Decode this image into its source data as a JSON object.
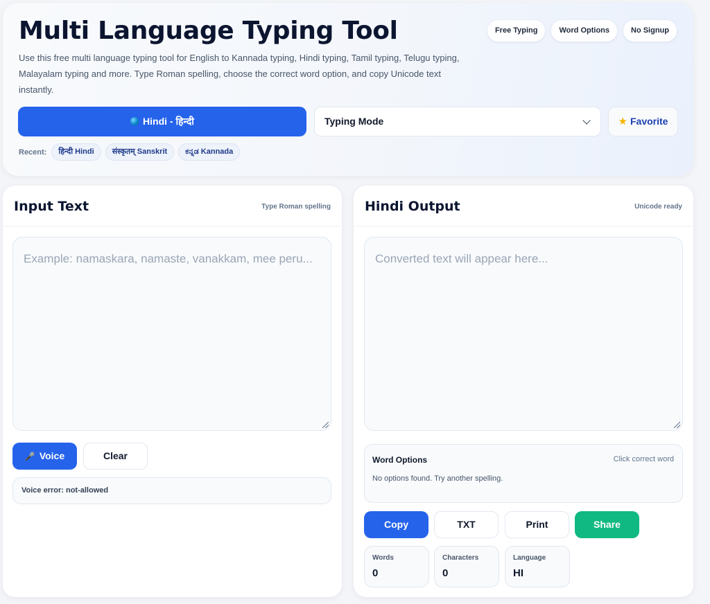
{
  "hero": {
    "title": "Multi Language Typing Tool",
    "description": "Use this free multi language typing tool for English to Kannada typing, Hindi typing, Tamil typing, Telugu typing, Malayalam typing and more. Type Roman spelling, choose the correct word option, and copy Unicode text instantly.",
    "pills": [
      "Free Typing",
      "Word Options",
      "No Signup"
    ],
    "language_button": "Hindi - हिन्दी",
    "mode_select": "Typing Mode",
    "favorite_label": "Favorite",
    "recent_label": "Recent:",
    "recent": [
      "हिन्दी Hindi",
      "संस्कृतम् Sanskrit",
      "ಕನ್ನಡ Kannada"
    ]
  },
  "input_panel": {
    "title": "Input Text",
    "hint": "Type Roman spelling",
    "placeholder": "Example: namaskara, namaste, vanakkam, mee peru...",
    "voice_label": "Voice",
    "clear_label": "Clear",
    "status": "Voice error: not-allowed"
  },
  "output_panel": {
    "title": "Hindi Output",
    "hint": "Unicode ready",
    "placeholder": "Converted text will appear here...",
    "word_options_title": "Word Options",
    "word_options_hint": "Click correct word",
    "word_options_message": "No options found. Try another spelling.",
    "buttons": {
      "copy": "Copy",
      "txt": "TXT",
      "print": "Print",
      "share": "Share"
    },
    "stats": [
      {
        "label": "Words",
        "value": "0"
      },
      {
        "label": "Characters",
        "value": "0"
      },
      {
        "label": "Language",
        "value": "HI"
      }
    ]
  },
  "colors": {
    "accent": "#2563eb",
    "share": "#10b981",
    "favorite_star": "#f5b301"
  },
  "icons": {
    "language": "globe-icon",
    "favorite": "star-icon",
    "voice": "microphone-icon",
    "dropdown": "chevron-down-icon",
    "resize": "resize-grip-icon"
  }
}
